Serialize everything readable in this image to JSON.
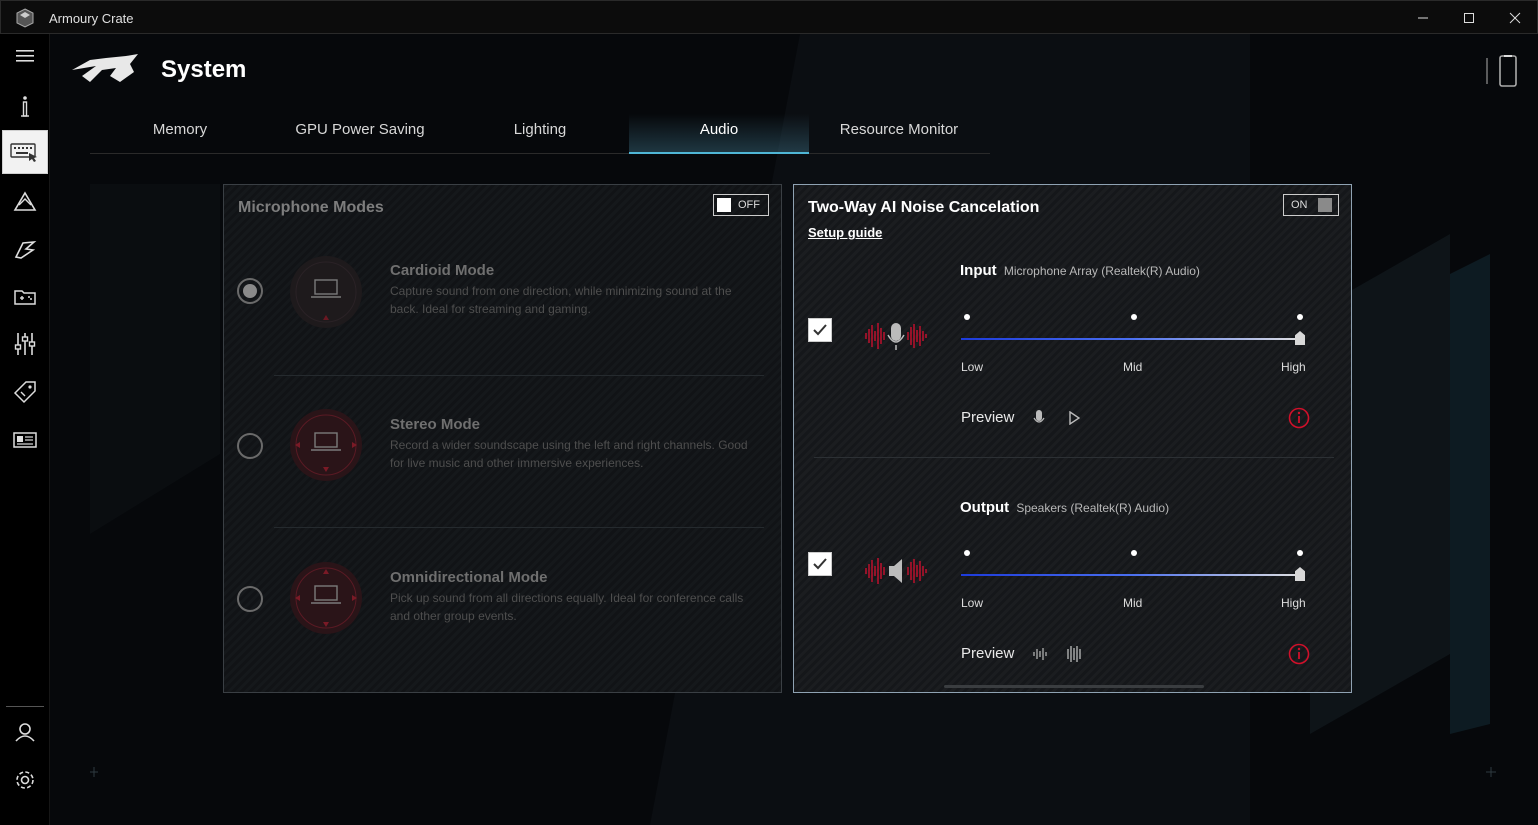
{
  "window": {
    "title": "Armoury Crate"
  },
  "header": {
    "title": "System"
  },
  "tabs": [
    {
      "label": "Memory",
      "active": false
    },
    {
      "label": "GPU Power Saving",
      "active": false
    },
    {
      "label": "Lighting",
      "active": false
    },
    {
      "label": "Audio",
      "active": true
    },
    {
      "label": "Resource Monitor",
      "active": false
    }
  ],
  "sidebar": {
    "items": [
      "menu-icon",
      "device-info-icon",
      "keyboard-system-icon",
      "aura-icon",
      "armoury-icon",
      "game-library-icon",
      "scenario-profiles-icon",
      "deals-icon",
      "news-icon",
      "user-center-icon",
      "settings-icon"
    ],
    "active": "keyboard-system-icon"
  },
  "mic_modes": {
    "title": "Microphone Modes",
    "toggle": "OFF",
    "modes": [
      {
        "title": "Cardioid Mode",
        "desc": "Capture sound from one direction, while minimizing sound at the back. Ideal for streaming and gaming.",
        "selected": true
      },
      {
        "title": "Stereo Mode",
        "desc": "Record a wider soundscape using the left and right channels. Good for live music and other immersive experiences.",
        "selected": false
      },
      {
        "title": "Omnidirectional Mode",
        "desc": "Pick up sound from all directions equally. Ideal for conference calls and other group events.",
        "selected": false
      }
    ]
  },
  "noise_cancel": {
    "title": "Two-Way AI Noise Cancelation",
    "toggle": "ON",
    "setup_guide": "Setup guide",
    "input": {
      "label": "Input",
      "device": "Microphone Array (Realtek(R) Audio)",
      "checked": true,
      "level": "High",
      "levels": [
        "Low",
        "Mid",
        "High"
      ],
      "preview": "Preview"
    },
    "output": {
      "label": "Output",
      "device": "Speakers (Realtek(R) Audio)",
      "checked": true,
      "level": "High",
      "levels": [
        "Low",
        "Mid",
        "High"
      ],
      "preview": "Preview"
    }
  },
  "colors": {
    "accent": "#4fb6d6",
    "rog_red": "#d0102a",
    "slider_blue": "#1d3bdb"
  }
}
